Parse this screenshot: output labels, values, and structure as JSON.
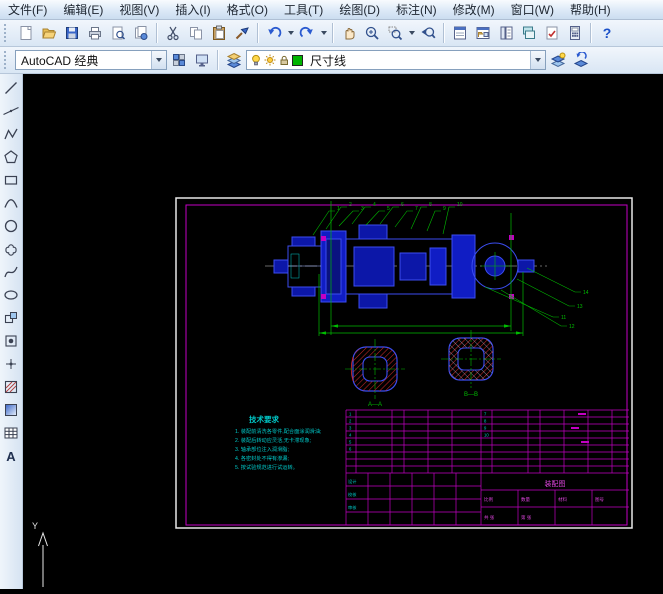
{
  "menubar": {
    "items": [
      "文件(F)",
      "编辑(E)",
      "视图(V)",
      "插入(I)",
      "格式(O)",
      "工具(T)",
      "绘图(D)",
      "标注(N)",
      "修改(M)",
      "窗口(W)",
      "帮助(H)"
    ]
  },
  "toolbars": {
    "standard_icons": [
      "new",
      "open",
      "save",
      "plot",
      "plot-preview",
      "publish",
      "cut",
      "copy",
      "paste",
      "match-properties",
      "undo",
      "redo",
      "pan",
      "zoom-realtime",
      "zoom-window",
      "zoom-previous",
      "properties",
      "designcenter",
      "tool-palettes",
      "sheet-set-manager",
      "markup-set-manager",
      "quickcalc",
      "help"
    ],
    "workspace": {
      "value": "AutoCAD 经典"
    },
    "layers": {
      "current": "尺寸线",
      "color": "#00b400"
    },
    "draw_icons": [
      "line",
      "construction-line",
      "polyline",
      "polygon",
      "rectangle",
      "arc",
      "circle",
      "revcloud",
      "spline",
      "ellipse",
      "insert-block",
      "make-block",
      "point",
      "hatch",
      "gradient",
      "table",
      "mtext"
    ],
    "mtext_icon_label": "A"
  },
  "drawing": {
    "tech_requirements": {
      "title": "技术要求",
      "lines": [
        "1. 装配前清洗各零件,配合面涂润滑油;",
        "2. 装配后转动应灵活,无卡滞现象;",
        "3. 轴承部位注入润滑脂;",
        "4. 各密封处不得有渗漏;",
        "5. 按试验规范进行试运转。"
      ]
    },
    "section_labels": {
      "left": "A—A",
      "right": "B—B"
    },
    "callouts": [
      "1",
      "2",
      "3",
      "4",
      "5",
      "6",
      "7",
      "8",
      "9",
      "10",
      "11",
      "12",
      "13",
      "14"
    ],
    "bom_rows": [
      "1",
      "2",
      "3",
      "4",
      "5",
      "6",
      "7",
      "8",
      "9",
      "10"
    ],
    "titleblock": {
      "name": "装配图",
      "labels": [
        "设计",
        "校核",
        "审核",
        "比例",
        "数量",
        "材料",
        "图号",
        "共 张",
        "第 张"
      ]
    },
    "ucs": {
      "y_label": "Y"
    }
  },
  "colors": {
    "canvas_bg": "#000000",
    "frame_white": "#e8e8e8",
    "frame_magenta": "#c400c4",
    "geometry_blue": "#2c3ee0",
    "dim_green": "#00bb00",
    "hatch_red": "#c62828",
    "text_cyan": "#00c8c8"
  }
}
